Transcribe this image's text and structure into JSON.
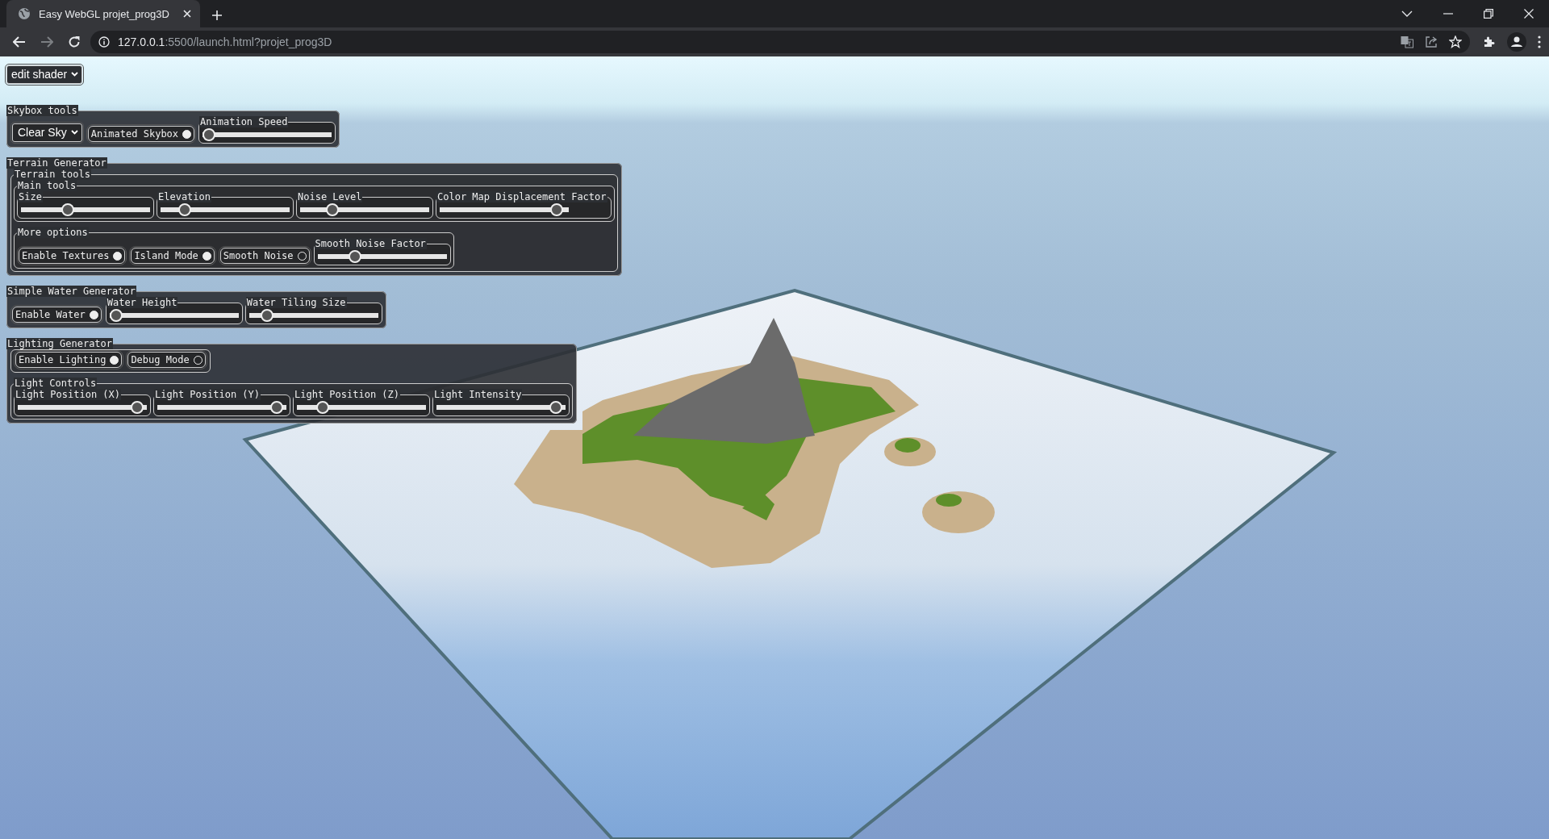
{
  "browser": {
    "tab_title": "Easy WebGL projet_prog3D",
    "url_host": "127.0.0.1",
    "url_path": ":5500/launch.html?projet_prog3D",
    "forward_disabled": true
  },
  "shader_menu": {
    "value": "edit shader"
  },
  "panels": [
    {
      "title": "Skybox tools",
      "items": [
        {
          "kind": "select",
          "value": "Clear Sky"
        },
        {
          "kind": "toggle",
          "label": "Animated Skybox",
          "on": true
        },
        {
          "kind": "slider",
          "label": "Animation Speed",
          "level": 0.0
        }
      ]
    },
    {
      "title": "Terrain Generator",
      "items": [
        {
          "kind": "group",
          "title": "Terrain tools",
          "items": [
            {
              "kind": "group",
              "title": "Main tools",
              "items": [
                {
                  "kind": "slider",
                  "label": "Size",
                  "level": 0.35
                },
                {
                  "kind": "slider",
                  "label": "Elevation",
                  "level": 0.15
                },
                {
                  "kind": "slider",
                  "label": "Noise Level",
                  "level": 0.22
                },
                {
                  "kind": "slider",
                  "label": "Color Map Displacement Factor",
                  "level": 0.95
                }
              ]
            },
            {
              "kind": "group",
              "title": "More options",
              "items": [
                {
                  "kind": "toggle",
                  "label": "Enable Textures",
                  "on": true
                },
                {
                  "kind": "toggle",
                  "label": "Island Mode",
                  "on": true
                },
                {
                  "kind": "toggle",
                  "label": "Smooth Noise",
                  "on": false
                },
                {
                  "kind": "slider",
                  "label": "Smooth Noise Factor",
                  "level": 0.27
                }
              ]
            }
          ]
        }
      ]
    },
    {
      "title": "Simple Water Generator",
      "items": [
        {
          "kind": "toggle",
          "label": "Enable Water",
          "on": true
        },
        {
          "kind": "slider",
          "label": "Water Height",
          "level": 0.0
        },
        {
          "kind": "slider",
          "label": "Water Tiling Size",
          "level": 0.1
        }
      ]
    },
    {
      "title": "Lighting Generator",
      "items": [
        {
          "kind": "row",
          "items": [
            {
              "kind": "toggle",
              "label": "Enable Lighting",
              "on": true
            },
            {
              "kind": "toggle",
              "label": "Debug Mode",
              "on": false
            }
          ]
        },
        {
          "kind": "group",
          "title": "Light Controls",
          "items": [
            {
              "kind": "slider",
              "label": "Light Position (X)",
              "level": 0.97
            },
            {
              "kind": "slider",
              "label": "Light Position (Y)",
              "level": 0.97
            },
            {
              "kind": "slider",
              "label": "Light Position (Z)",
              "level": 0.17
            },
            {
              "kind": "slider",
              "label": "Light Intensity",
              "level": 0.97
            }
          ]
        }
      ]
    }
  ]
}
